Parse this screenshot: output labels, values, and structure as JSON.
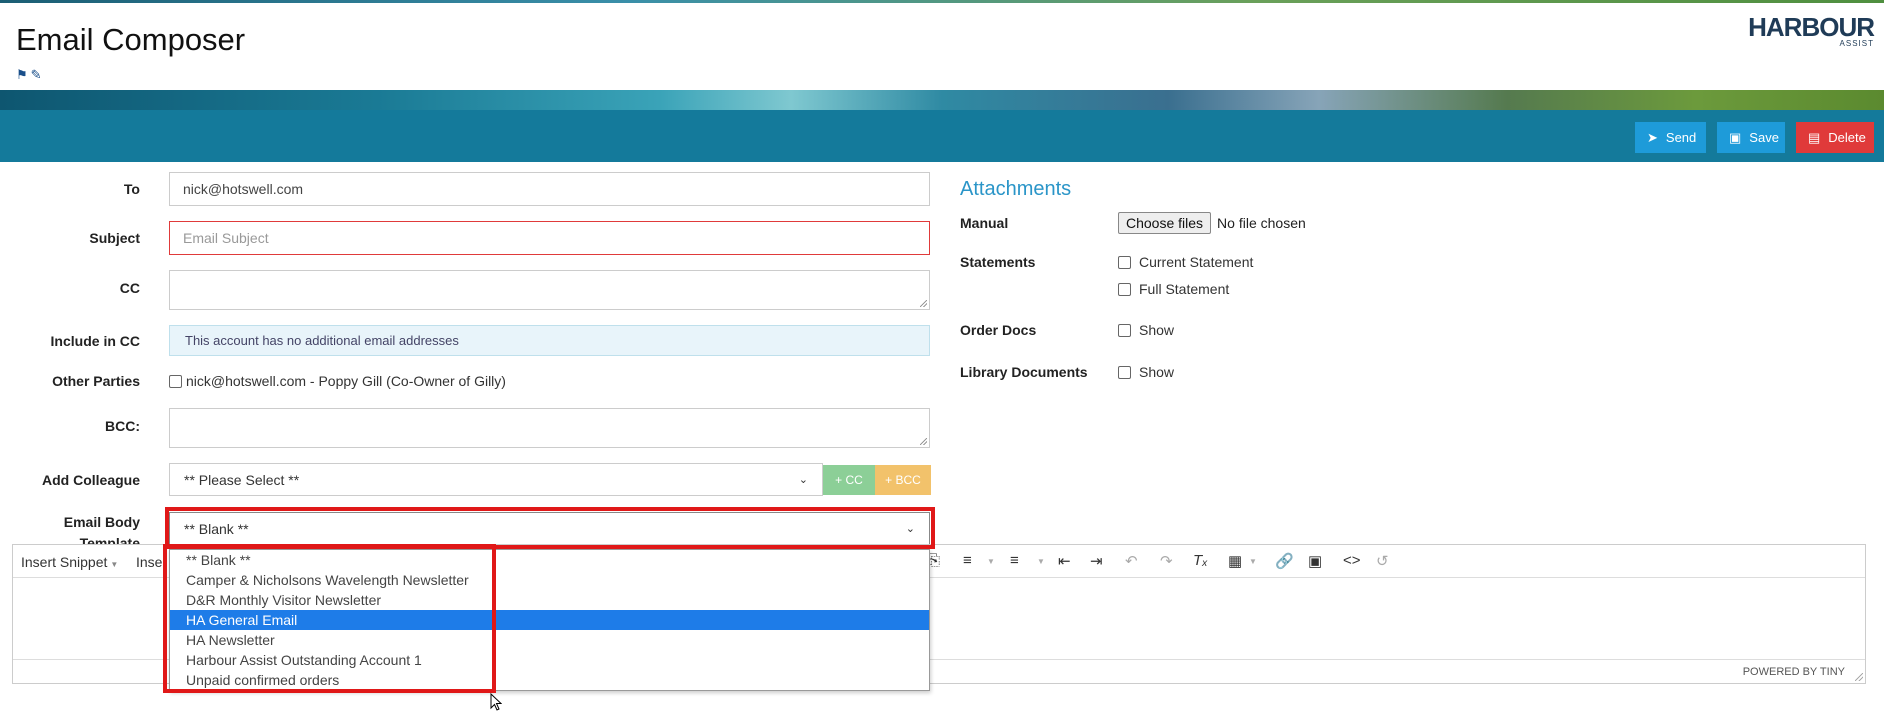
{
  "header": {
    "title": "Email Composer",
    "logo_main": "HARBOUR",
    "logo_sub": "ASSIST",
    "title_icons": [
      "tags-icon",
      "edit-icon"
    ]
  },
  "toolbar": {
    "send_label": "Send",
    "save_label": "Save",
    "delete_label": "Delete"
  },
  "form": {
    "to_label": "To",
    "to_value": "nick@hotswell.com",
    "subject_label": "Subject",
    "subject_placeholder": "Email Subject",
    "cc_label": "CC",
    "include_cc_label": "Include in CC",
    "include_cc_info": "This account has no additional email addresses",
    "other_parties_label": "Other Parties",
    "other_parties_option": "nick@hotswell.com - Poppy Gill (Co-Owner of Gilly)",
    "bcc_label": "BCC:",
    "add_colleague_label": "Add Colleague",
    "add_colleague_value": "** Please Select **",
    "add_cc_label": "+ CC",
    "add_bcc_label": "+ BCC",
    "template_label_1": "Email Body",
    "template_label_2": "Template",
    "template_value": "** Blank **",
    "template_options": [
      "** Blank **",
      "Camper & Nicholsons Wavelength Newsletter",
      "D&R Monthly Visitor Newsletter",
      "HA General Email",
      "HA Newsletter",
      "Harbour Assist Outstanding Account 1",
      "Unpaid confirmed orders"
    ],
    "template_highlighted": "HA General Email"
  },
  "attachments": {
    "title": "Attachments",
    "manual_label": "Manual",
    "choose_files_label": "Choose files",
    "no_file_text": "No file chosen",
    "statements_label": "Statements",
    "current_statement": "Current Statement",
    "full_statement": "Full Statement",
    "order_docs_label": "Order Docs",
    "order_docs_option": "Show",
    "library_docs_label": "Library Documents",
    "library_docs_option": "Show"
  },
  "editor": {
    "insert_snippet": "Insert Snippet",
    "insert_other": "Inse",
    "powered_by": "POWERED BY TINY"
  },
  "colors": {
    "toolbar": "#147a9b",
    "send": "#1e9bd9",
    "delete": "#e03a3a",
    "cc_button": "#8ccf97",
    "bcc_button": "#f2c26b",
    "highlight": "#e01818",
    "selected_option": "#1e7ce8"
  }
}
